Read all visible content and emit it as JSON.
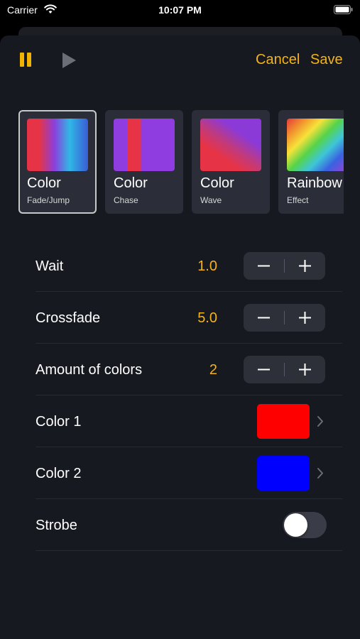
{
  "status_bar": {
    "carrier": "Carrier",
    "time": "10:07 PM"
  },
  "toolbar": {
    "cancel_label": "Cancel",
    "save_label": "Save",
    "accent_color": "#f5b316"
  },
  "effects": [
    {
      "title": "Color",
      "subtitle": "Fade/Jump",
      "selected": true
    },
    {
      "title": "Color",
      "subtitle": "Chase",
      "selected": false
    },
    {
      "title": "Color",
      "subtitle": "Wave",
      "selected": false
    },
    {
      "title": "Rainbow",
      "subtitle": "Effect",
      "selected": false
    }
  ],
  "settings": {
    "wait": {
      "label": "Wait",
      "value": "1.0"
    },
    "crossfade": {
      "label": "Crossfade",
      "value": "5.0"
    },
    "amount": {
      "label": "Amount of colors",
      "value": "2"
    },
    "color1": {
      "label": "Color 1",
      "color": "#ff0000"
    },
    "color2": {
      "label": "Color 2",
      "color": "#0000ff"
    },
    "strobe": {
      "label": "Strobe",
      "on": false
    }
  }
}
